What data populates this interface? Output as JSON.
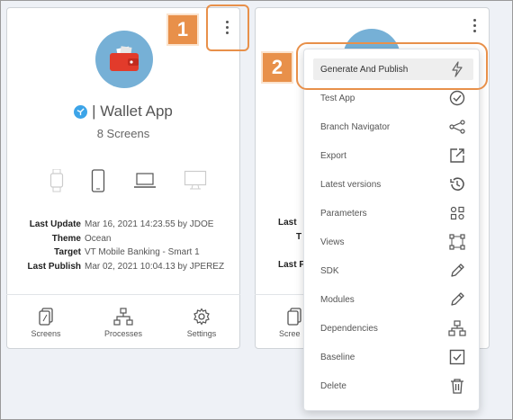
{
  "callouts": {
    "kebab_badge": "1",
    "menu_badge": "2"
  },
  "app_card": {
    "title": "| Wallet App",
    "screens": "8 Screens",
    "meta": [
      {
        "label": "Last Update",
        "value": "Mar 16, 2021 14:23.55 by JDOE"
      },
      {
        "label": "Theme",
        "value": "Ocean"
      },
      {
        "label": "Target",
        "value": "VT Mobile Banking - Smart 1"
      },
      {
        "label": "Last Publish",
        "value": "Mar 02, 2021 10:04.13 by JPEREZ"
      }
    ],
    "footer": {
      "screens": "Screens",
      "processes": "Processes",
      "settings": "Settings"
    },
    "devices": [
      "watch-icon",
      "phone-icon",
      "laptop-icon",
      "desktop-icon"
    ]
  },
  "second_card": {
    "partial_labels": [
      "Last",
      "T",
      "Last F"
    ],
    "partial_footer": "Scree"
  },
  "menu": {
    "items": [
      {
        "label": "Generate And Publish",
        "icon": "lightning-icon"
      },
      {
        "label": "Test App",
        "icon": "check-circle-icon"
      },
      {
        "label": "Branch Navigator",
        "icon": "branch-icon"
      },
      {
        "label": "Export",
        "icon": "export-icon"
      },
      {
        "label": "Latest versions",
        "icon": "history-icon"
      },
      {
        "label": "Parameters",
        "icon": "parameters-icon"
      },
      {
        "label": "Views",
        "icon": "views-icon"
      },
      {
        "label": "SDK",
        "icon": "pencil-icon"
      },
      {
        "label": "Modules",
        "icon": "pencil-icon"
      },
      {
        "label": "Dependencies",
        "icon": "hierarchy-icon"
      },
      {
        "label": "Baseline",
        "icon": "checkbox-icon"
      },
      {
        "label": "Delete",
        "icon": "trash-icon"
      }
    ]
  },
  "colors": {
    "accent": "#e8904a",
    "avatar_bg": "#76b0d6",
    "wallet": "#e23b2b",
    "app_icon": "#3ca4e8"
  }
}
